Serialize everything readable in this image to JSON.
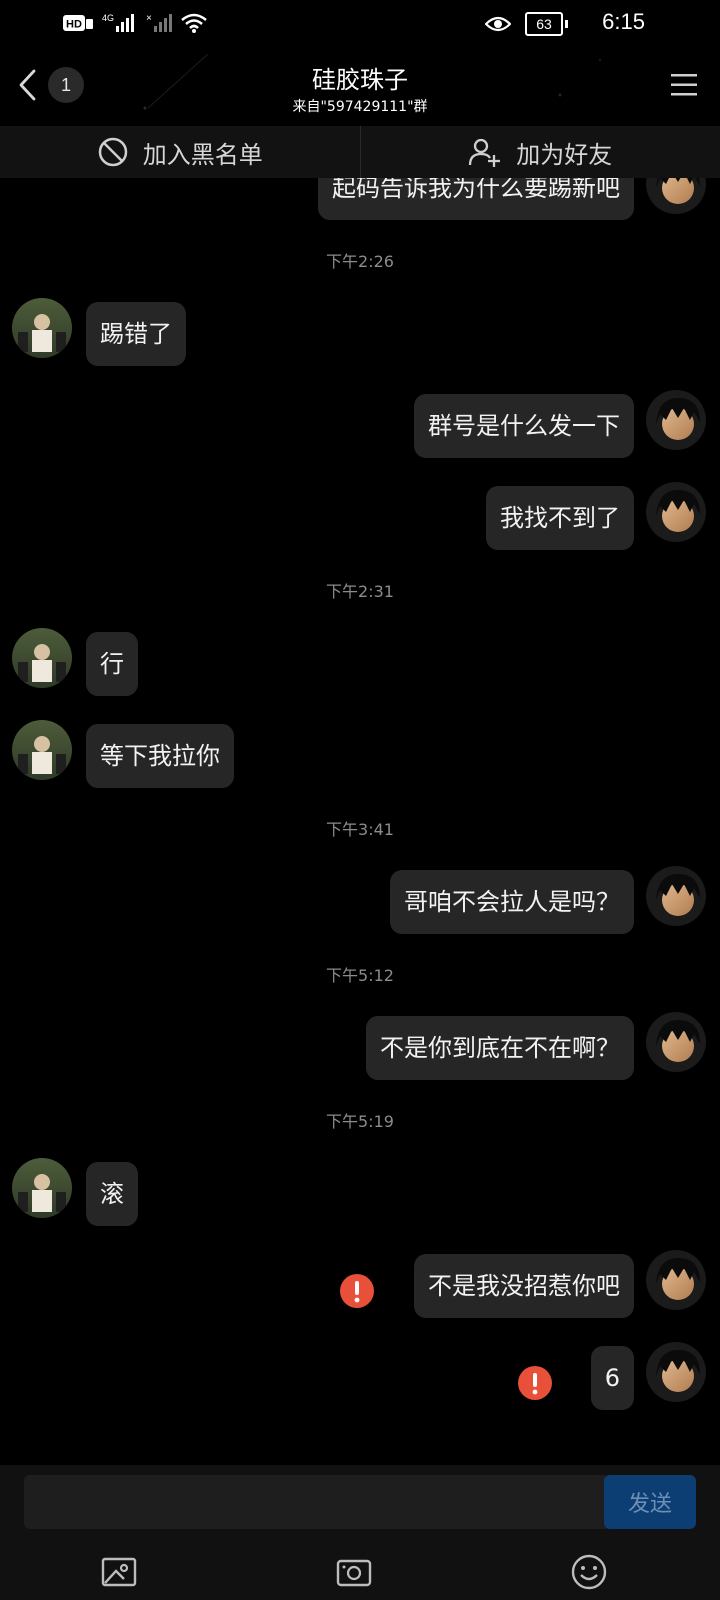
{
  "status_bar": {
    "time": "6:15",
    "battery": "63",
    "icons": [
      "hd-icon",
      "signal-4g-icon",
      "signal-bars-icon",
      "wifi-icon",
      "eye-icon",
      "battery-icon"
    ]
  },
  "header": {
    "back_icon": "chevron-left-icon",
    "unread_count": "1",
    "title": "硅胶珠子",
    "subtitle": "来自\"597429111\"群",
    "menu_icon": "hamburger-menu-icon"
  },
  "actions": {
    "blacklist_label": "加入黑名单",
    "add_friend_label": "加为好友",
    "blacklist_icon": "block-icon",
    "add_friend_icon": "add-user-icon"
  },
  "timestamps": [
    "下午2:26",
    "下午2:31",
    "下午3:41",
    "下午5:12",
    "下午5:19"
  ],
  "messages": [
    {
      "side": "right",
      "text": "起码告诉我为什么要踢新吧"
    },
    {
      "side": "left",
      "text": "踢错了"
    },
    {
      "side": "right",
      "text": "群号是什么发一下"
    },
    {
      "side": "right",
      "text": "我找不到了"
    },
    {
      "side": "left",
      "text": "行"
    },
    {
      "side": "left",
      "text": "等下我拉你"
    },
    {
      "side": "right",
      "text": "哥咱不会拉人是吗？"
    },
    {
      "side": "right",
      "text": "不是你到底在不在啊？"
    },
    {
      "side": "left",
      "text": "滚"
    },
    {
      "side": "right",
      "text": "不是我没招惹你吧",
      "failed": true
    },
    {
      "side": "right",
      "text": "6",
      "failed": true
    }
  ],
  "input": {
    "placeholder": "",
    "send_label": "发送"
  },
  "toolbar": {
    "icons": [
      "image-icon",
      "camera-icon",
      "emoji-icon"
    ]
  },
  "colors": {
    "background": "#000000",
    "bubble": "#262626",
    "error": "#e8503a",
    "send_button": "#0c3e73"
  }
}
